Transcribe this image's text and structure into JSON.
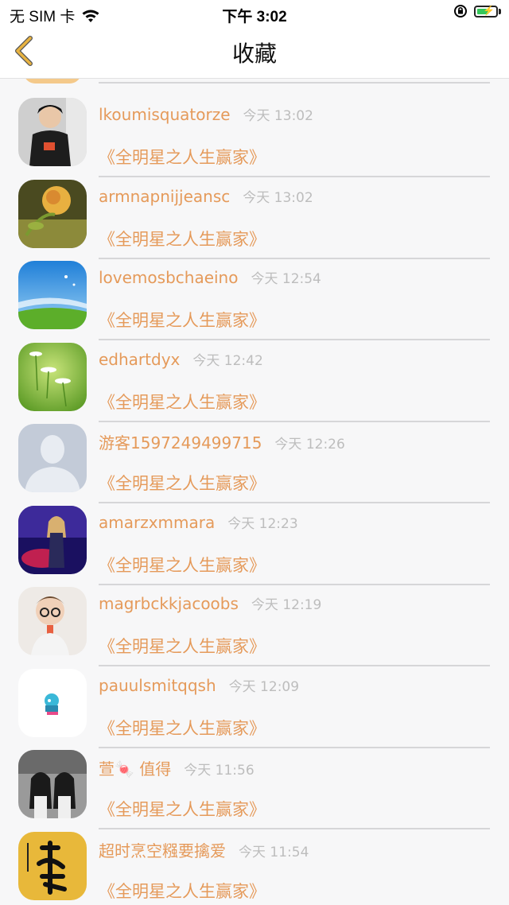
{
  "status_bar": {
    "carrier": "无 SIM 卡",
    "time": "下午 3:02",
    "battery_level": 0.7
  },
  "nav": {
    "title": "收藏"
  },
  "colors": {
    "accent": "#e59a5a",
    "timestamp": "#bdbdbd",
    "back_icon": "#e8b341"
  },
  "items": [
    {
      "name": "lkoumisquatorze",
      "time": "今天 13:02",
      "title": "《全明星之人生赢家》",
      "avatar": "person-dark-shirt"
    },
    {
      "name": "armnapnijjeansc",
      "time": "今天 13:02",
      "title": "《全明星之人生赢家》",
      "avatar": "yellow-rose"
    },
    {
      "name": "lovemosbchaeino",
      "time": "今天 12:54",
      "title": "《全明星之人生赢家》",
      "avatar": "blue-sky-grass"
    },
    {
      "name": "edhartdyx",
      "time": "今天 12:42",
      "title": "《全明星之人生赢家》",
      "avatar": "green-flowers"
    },
    {
      "name": "游客1597249499715",
      "time": "今天 12:26",
      "title": "《全明星之人生赢家》",
      "avatar": "default-silhouette"
    },
    {
      "name": "amarzxmmara",
      "time": "今天 12:23",
      "title": "《全明星之人生赢家》",
      "avatar": "woman-purple"
    },
    {
      "name": "magrbckkjacoobs",
      "time": "今天 12:19",
      "title": "《全明星之人生赢家》",
      "avatar": "child-glasses"
    },
    {
      "name": "pauulsmitqqsh",
      "time": "今天 12:09",
      "title": "《全明星之人生赢家》",
      "avatar": "cartoon-character"
    },
    {
      "name": "萱🍬 值得",
      "time": "今天 11:56",
      "title": "《全明星之人生赢家》",
      "avatar": "two-girls-bw"
    },
    {
      "name": "超时烹空糨要擒爱",
      "time": "今天 11:54",
      "title": "《全明星之人生赢家》",
      "avatar": "fu-calligraphy"
    }
  ]
}
